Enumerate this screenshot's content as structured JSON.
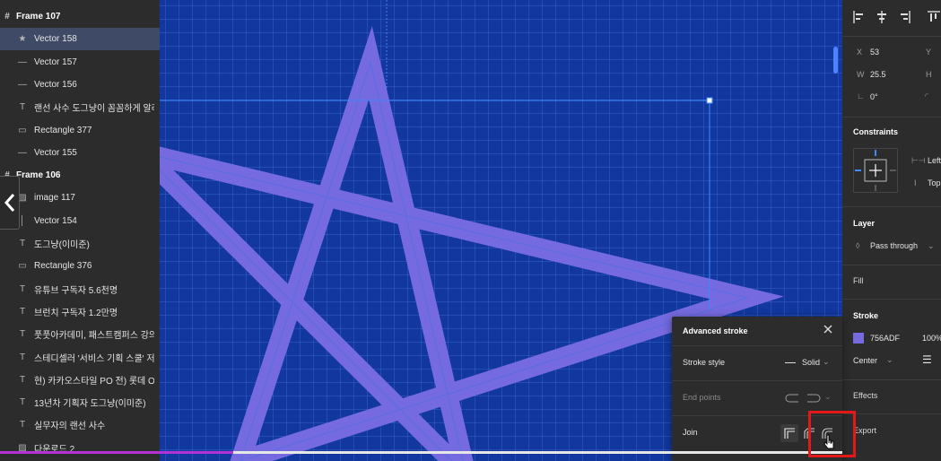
{
  "layers": [
    {
      "name": "Frame 107",
      "type": "frame",
      "icon": "hash-icon"
    },
    {
      "name": "Vector 158",
      "type": "star",
      "icon": "star-icon",
      "selected": true
    },
    {
      "name": "Vector 157",
      "type": "vector",
      "icon": "line-icon"
    },
    {
      "name": "Vector 156",
      "type": "vector",
      "icon": "line-icon"
    },
    {
      "name": "랜선 사수 도그냥이 꼼꼼하게 알려드...",
      "type": "text",
      "icon": "text-icon"
    },
    {
      "name": "Rectangle 377",
      "type": "rect",
      "icon": "rectangle-icon"
    },
    {
      "name": "Vector 155",
      "type": "vector",
      "icon": "line-icon"
    },
    {
      "name": "Frame 106",
      "type": "frame",
      "icon": "hash-icon"
    },
    {
      "name": "image 117",
      "type": "image",
      "icon": "image-icon"
    },
    {
      "name": "Vector 154",
      "type": "vector",
      "icon": "vertical-line-icon"
    },
    {
      "name": "도그냥(이미준)",
      "type": "text",
      "icon": "text-icon"
    },
    {
      "name": "Rectangle 376",
      "type": "rect",
      "icon": "rectangle-icon"
    },
    {
      "name": "유튜브 구독자 5.6천명",
      "type": "text",
      "icon": "text-icon"
    },
    {
      "name": "브런치 구독자 1.2만명",
      "type": "text",
      "icon": "text-icon"
    },
    {
      "name": "풋풋아카데미, 패스트캠퍼스 강의",
      "type": "text",
      "icon": "text-icon"
    },
    {
      "name": "스테디셀러 '서비스 기획 스쿨' 저자",
      "type": "text",
      "icon": "text-icon"
    },
    {
      "name": "현) 카카오스타일 PO 전) 롯데 ON ...",
      "type": "text",
      "icon": "text-icon"
    },
    {
      "name": "13년차 기획자 도그냥(이미준)",
      "type": "text",
      "icon": "text-icon"
    },
    {
      "name": "실무자의 랜선 사수",
      "type": "text",
      "icon": "text-icon"
    },
    {
      "name": "다운로드 2",
      "type": "image",
      "icon": "image-icon"
    }
  ],
  "right_panel": {
    "x_label": "X",
    "x_value": "53",
    "y_label": "Y",
    "w_label": "W",
    "w_value": "25.5",
    "h_label": "H",
    "rotation_value": "0°",
    "constraints_title": "Constraints",
    "constraint_h": "Left",
    "constraint_v": "Top",
    "layer_title": "Layer",
    "blend_mode": "Pass through",
    "fill_title": "Fill",
    "stroke_title": "Stroke",
    "stroke_color_hex": "756ADF",
    "stroke_opacity": "100%",
    "stroke_position": "Center",
    "effects_title": "Effects",
    "export_title": "Export"
  },
  "advanced_stroke": {
    "title": "Advanced stroke",
    "stroke_style_label": "Stroke style",
    "stroke_style_value": "Solid",
    "end_points_label": "End points",
    "join_label": "Join"
  },
  "colors": {
    "canvas_bg": "#12389f",
    "star_stroke": "#756ADF",
    "panel_bg": "#2c2c2c",
    "selection": "#3f4b66",
    "highlight_box": "#e31818",
    "progress": "#b232d6"
  }
}
